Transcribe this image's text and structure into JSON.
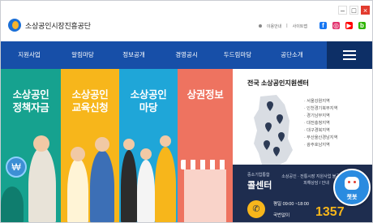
{
  "header": {
    "site_name": "소상공인시장진흥공단",
    "util_links": [
      "이용안내",
      "사이트맵"
    ],
    "sns_icons": [
      "facebook-icon",
      "instagram-icon",
      "youtube-icon",
      "blog-icon"
    ],
    "sns_colors": [
      "#1877f2",
      "#e1306c",
      "#ff0000",
      "#2db400"
    ]
  },
  "window_controls": [
    "minimize",
    "restore",
    "close"
  ],
  "nav": {
    "items": [
      "지원사업",
      "알림마당",
      "정보공개",
      "경영공시",
      "두드림마당",
      "공단소개"
    ]
  },
  "banners": [
    {
      "title": "소상공인\n정책자금",
      "color": "#16a28f"
    },
    {
      "title": "소상공인\n교육신청",
      "color": "#f7b61b"
    },
    {
      "title": "소상공인\n마당",
      "color": "#1fa6d8"
    },
    {
      "title": "상권정보",
      "color": "#ee7360"
    }
  ],
  "support_centers": {
    "title": "전국 소상공인지원센터",
    "regions": [
      "서울강원지역",
      "인천경기북부지역",
      "경기남부지역",
      "대전충청지역",
      "대구경북지역",
      "부산울산경남지역",
      "광주호남지역"
    ]
  },
  "call_center": {
    "org": "중소기업통합",
    "name": "콜센터",
    "desc": "소상공인 · 전통시장 지원사업 불공정거래 피해상담 / 안내",
    "hours": "평일 09:00 ~18:00",
    "holiday": "국번없이",
    "number": "1357"
  },
  "chatbot": {
    "label": "챗봇"
  }
}
